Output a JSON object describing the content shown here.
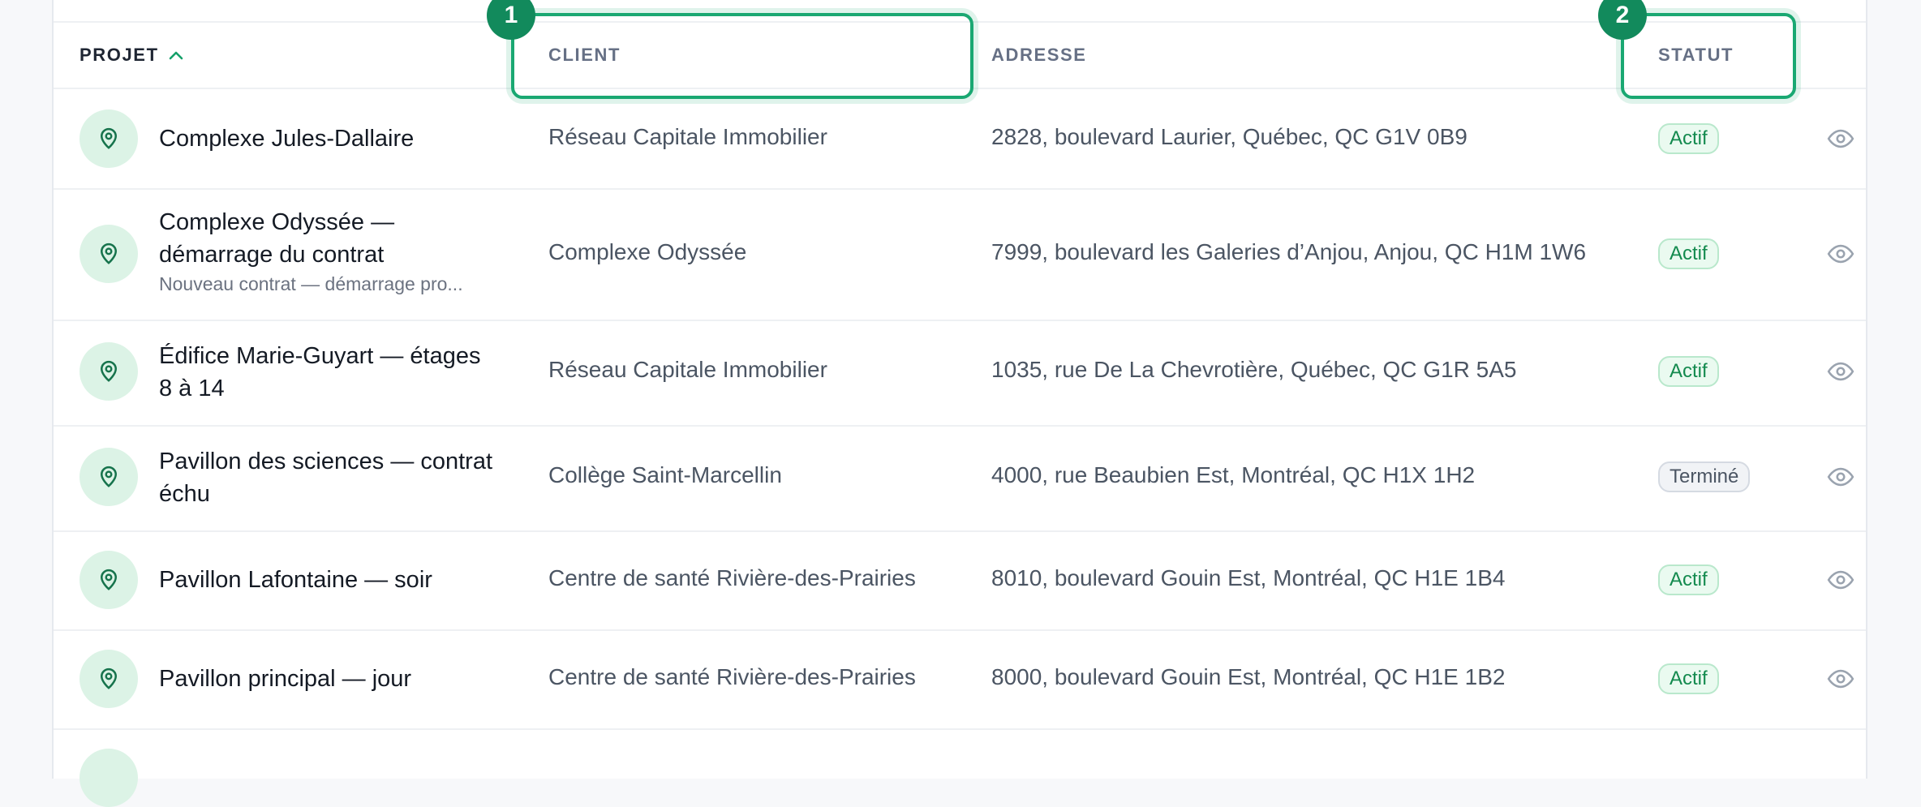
{
  "table": {
    "columns": {
      "projet": "PROJET",
      "client": "CLIENT",
      "adresse": "ADRESSE",
      "statut": "STATUT"
    },
    "sort_indicator": "chevron-up-icon",
    "rows": [
      {
        "projet": "Complexe Jules-Dallaire",
        "projet_sub": "",
        "client": "Réseau Capitale Immobilier",
        "adresse": "2828, boulevard Laurier, Québec, QC G1V 0B9",
        "statut": "Actif"
      },
      {
        "projet": "Complexe Odyssée — démarrage du contrat",
        "projet_sub": "Nouveau contrat — démarrage pro...",
        "client": "Complexe Odyssée",
        "adresse": "7999, boulevard les Galeries d’Anjou, Anjou, QC H1M 1W6",
        "statut": "Actif"
      },
      {
        "projet": "Édifice Marie-Guyart — étages 8 à 14",
        "projet_sub": "",
        "client": "Réseau Capitale Immobilier",
        "adresse": "1035, rue De La Chevrotière, Québec, QC G1R 5A5",
        "statut": "Actif"
      },
      {
        "projet": "Pavillon des sciences — contrat échu",
        "projet_sub": "",
        "client": "Collège Saint-Marcellin",
        "adresse": "4000, rue Beaubien Est, Montréal, QC H1X 1H2",
        "statut": "Terminé"
      },
      {
        "projet": "Pavillon Lafontaine — soir",
        "projet_sub": "",
        "client": "Centre de santé Rivière-des-Prairies",
        "adresse": "8010, boulevard Gouin Est, Montréal, QC H1E 1B4",
        "statut": "Actif"
      },
      {
        "projet": "Pavillon principal — jour",
        "projet_sub": "",
        "client": "Centre de santé Rivière-des-Prairies",
        "adresse": "8000, boulevard Gouin Est, Montréal, QC H1E 1B2",
        "statut": "Actif"
      }
    ]
  },
  "annotations": {
    "marker_1": "1",
    "marker_2": "2"
  },
  "colors": {
    "accent": "#1aa872",
    "badge_active": "#138a4e",
    "badge_done": "#4b5563"
  }
}
